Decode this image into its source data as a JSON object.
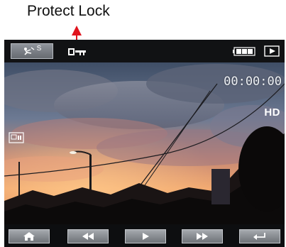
{
  "annotation": {
    "label": "Protect Lock",
    "arrow_color": "#e0141e"
  },
  "topbar": {
    "mode_button": {
      "icon": "scene-mode-icon",
      "superscript": "S"
    },
    "status_icons": [
      "protect-lock-icon",
      "battery-icon",
      "playback-mode-icon"
    ]
  },
  "viewer": {
    "timecode": "00:00:00",
    "quality_badge": "HD",
    "file_icon": "file-icon"
  },
  "controls": [
    {
      "name": "home-button",
      "icon": "home-icon"
    },
    {
      "name": "rewind-button",
      "icon": "rewind-icon"
    },
    {
      "name": "play-button",
      "icon": "play-icon"
    },
    {
      "name": "fast-forward-button",
      "icon": "fast-forward-icon"
    },
    {
      "name": "return-button",
      "icon": "return-icon"
    }
  ],
  "colors": {
    "bar_background": "#111214",
    "button_face": "#8f949b",
    "sky_top": "#4a5a70",
    "sunset": "#e88a5c",
    "ground": "#0c0a0a"
  }
}
